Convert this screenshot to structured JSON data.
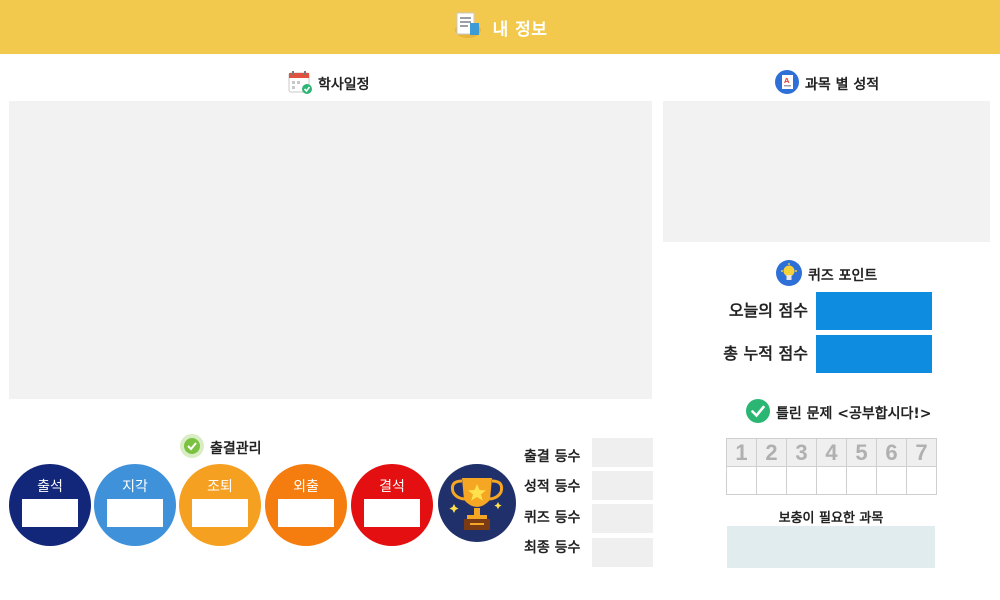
{
  "header": {
    "title": "내 정보",
    "icon": "document-icon"
  },
  "schedule": {
    "title": "학사일정",
    "icon": "calendar-icon"
  },
  "grades": {
    "title": "과목 별 성적",
    "icon": "grade-report-icon"
  },
  "quiz": {
    "title": "퀴즈 포인트",
    "icon": "lightbulb-icon",
    "today_label": "오늘의 점수",
    "total_label": "총 누적 점수",
    "today_value": "",
    "total_value": ""
  },
  "attendance": {
    "title": "출결관리",
    "icon": "checkmark-icon",
    "items": [
      {
        "label": "출석",
        "color": "#12267a",
        "value": ""
      },
      {
        "label": "지각",
        "color": "#3f92d9",
        "value": ""
      },
      {
        "label": "조퇴",
        "color": "#f5a021",
        "value": ""
      },
      {
        "label": "외출",
        "color": "#f57c0f",
        "value": ""
      },
      {
        "label": "결석",
        "color": "#e40f10",
        "value": ""
      }
    ]
  },
  "ranks": {
    "icon": "trophy-icon",
    "items": [
      {
        "label": "출결 등수",
        "value": ""
      },
      {
        "label": "성적 등수",
        "value": ""
      },
      {
        "label": "퀴즈 등수",
        "value": ""
      },
      {
        "label": "최종 등수",
        "value": ""
      }
    ]
  },
  "wrong": {
    "title": "틀린 문제 <공부합시다!>",
    "icon": "green-check-icon",
    "numbers": [
      "1",
      "2",
      "3",
      "4",
      "5",
      "6",
      "7"
    ]
  },
  "needed": {
    "title": "보충이 필요한 과목",
    "value": ""
  },
  "colors": {
    "header": "#f2c94c",
    "panel": "#f3f2f2",
    "quiz_box": "#0d8ce0",
    "need_box": "#e0eced"
  }
}
